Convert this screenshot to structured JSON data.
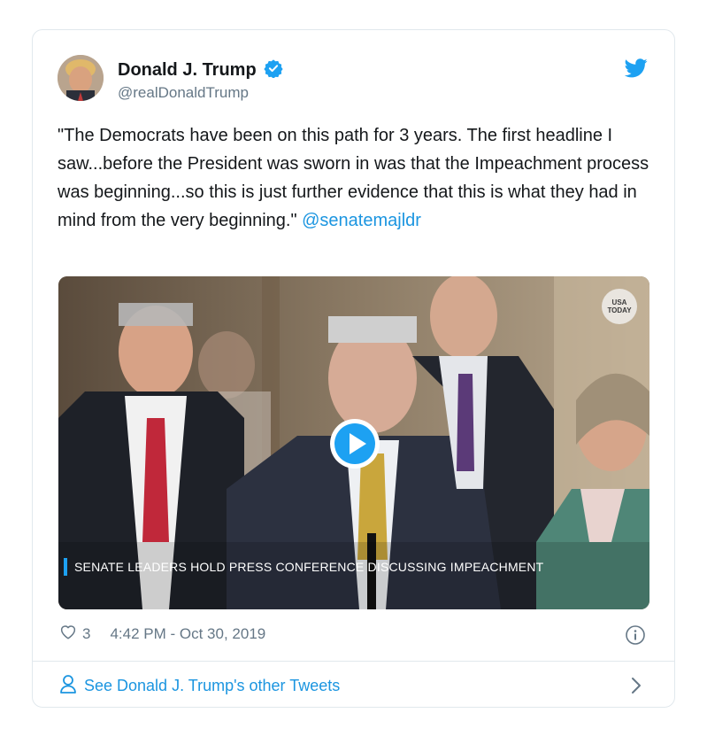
{
  "tweet": {
    "author_name": "Donald J. Trump",
    "author_handle": "@realDonaldTrump",
    "text": "\"The Democrats have been on this path for 3 years. The first headline I saw...before the President was sworn in was that the Impeachment process was beginning...so this is just further evidence that this is what they had in mind from the very beginning.\" ",
    "mention": "@senatemajldr",
    "likes": "3",
    "timestamp": "4:42 PM - Oct 30, 2019"
  },
  "video": {
    "caption": "SENATE LEADERS HOLD PRESS CONFERENCE DISCUSSING IMPEACHMENT",
    "badge_line1": "USA",
    "badge_line2": "TODAY"
  },
  "footer": {
    "link_label": "See Donald J. Trump's other Tweets"
  },
  "colors": {
    "accent": "#1b95e0",
    "twitter_blue": "#1da1f2",
    "muted": "#657786",
    "border": "#e1e8ed"
  },
  "icons": [
    "verified-badge-icon",
    "twitter-bird-icon",
    "play-icon",
    "heart-icon",
    "info-icon",
    "person-icon",
    "chevron-right-icon"
  ]
}
